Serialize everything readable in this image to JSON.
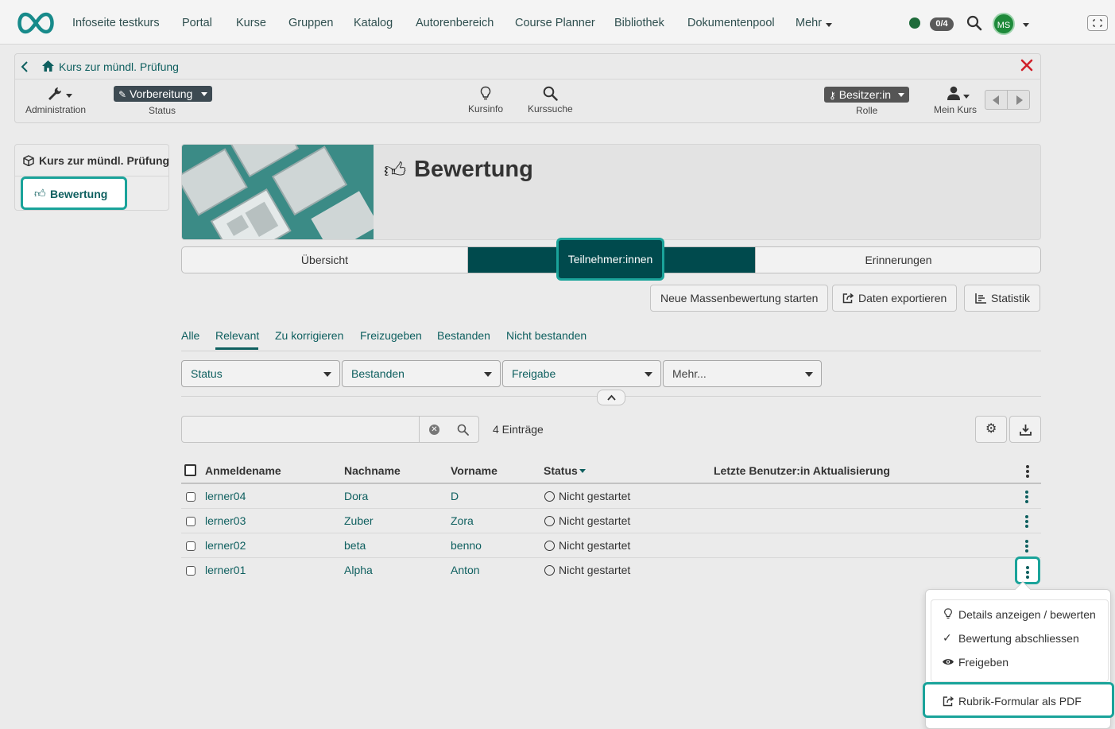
{
  "topnav": {
    "items": [
      "Infoseite testkurs",
      "Portal",
      "Kurse",
      "Gruppen",
      "Katalog",
      "Autorenbereich",
      "Course Planner",
      "Bibliothek",
      "Dokumentenpool",
      "Mehr"
    ],
    "badge": "0/4",
    "avatar": "MS",
    "colors": {
      "accent": "#0e5f5f",
      "status_dot": "#1e6b3a",
      "avatar": "#1e8a3a"
    }
  },
  "course": {
    "title": "Kurs zur mündl. Prüfung",
    "admin_label": "Administration",
    "status_value": "Vorbereitung",
    "status_label": "Status",
    "kursinfo": "Kursinfo",
    "kurssuche": "Kurssuche",
    "role_value": "Besitzer:in",
    "role_label": "Rolle",
    "mein_kurs": "Mein Kurs"
  },
  "menu": {
    "root": "Kurs zur mündl. Prüfung",
    "active": "Bewertung"
  },
  "page": {
    "title": "Bewertung",
    "tabs": [
      "Übersicht",
      "Teilnehmer:innen",
      "Erinnerungen"
    ],
    "active_tab": "Teilnehmer:innen"
  },
  "actions": {
    "mass": "Neue Massenbewertung starten",
    "export": "Daten exportieren",
    "stats": "Statistik"
  },
  "filters": {
    "tabs": [
      "Alle",
      "Relevant",
      "Zu korrigieren",
      "Freizugeben",
      "Bestanden",
      "Nicht bestanden"
    ],
    "active": "Relevant",
    "selects": [
      "Status",
      "Bestanden",
      "Freigabe",
      "Mehr..."
    ]
  },
  "search": {
    "placeholder": "",
    "count": "4 Einträge"
  },
  "table": {
    "headers": [
      "Anmeldename",
      "Nachname",
      "Vorname",
      "Status",
      "Letzte Benutzer:in Aktualisierung"
    ],
    "rows": [
      {
        "login": "lerner04",
        "last": "Dora",
        "first": "D",
        "status": "Nicht gestartet"
      },
      {
        "login": "lerner03",
        "last": "Zuber",
        "first": "Zora",
        "status": "Nicht gestartet"
      },
      {
        "login": "lerner02",
        "last": "beta",
        "first": "benno",
        "status": "Nicht gestartet"
      },
      {
        "login": "lerner01",
        "last": "Alpha",
        "first": "Anton",
        "status": "Nicht gestartet"
      }
    ]
  },
  "dropdown": {
    "items": [
      "Details anzeigen / bewerten",
      "Bewertung abschliessen",
      "Freigeben",
      "Rubrik-Formular als PDF"
    ]
  }
}
